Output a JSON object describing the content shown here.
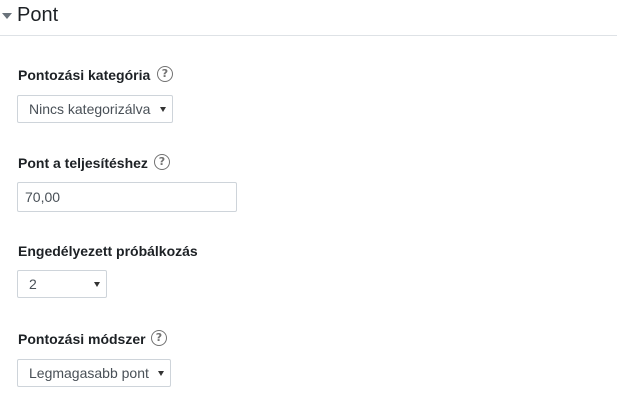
{
  "section": {
    "title": "Pont"
  },
  "fields": {
    "grade_category": {
      "label": "Pontozási kategória",
      "value": "Nincs kategorizálva",
      "help_icon": "question-circle-icon"
    },
    "grade_to_pass": {
      "label": "Pont a teljesítéshez",
      "value": "70,00",
      "help_icon": "question-circle-icon"
    },
    "attempts_allowed": {
      "label": "Engedélyezett próbálkozás",
      "value": "2"
    },
    "grading_method": {
      "label": "Pontozási módszer",
      "value": "Legmagasabb pont",
      "help_icon": "question-circle-icon"
    }
  }
}
